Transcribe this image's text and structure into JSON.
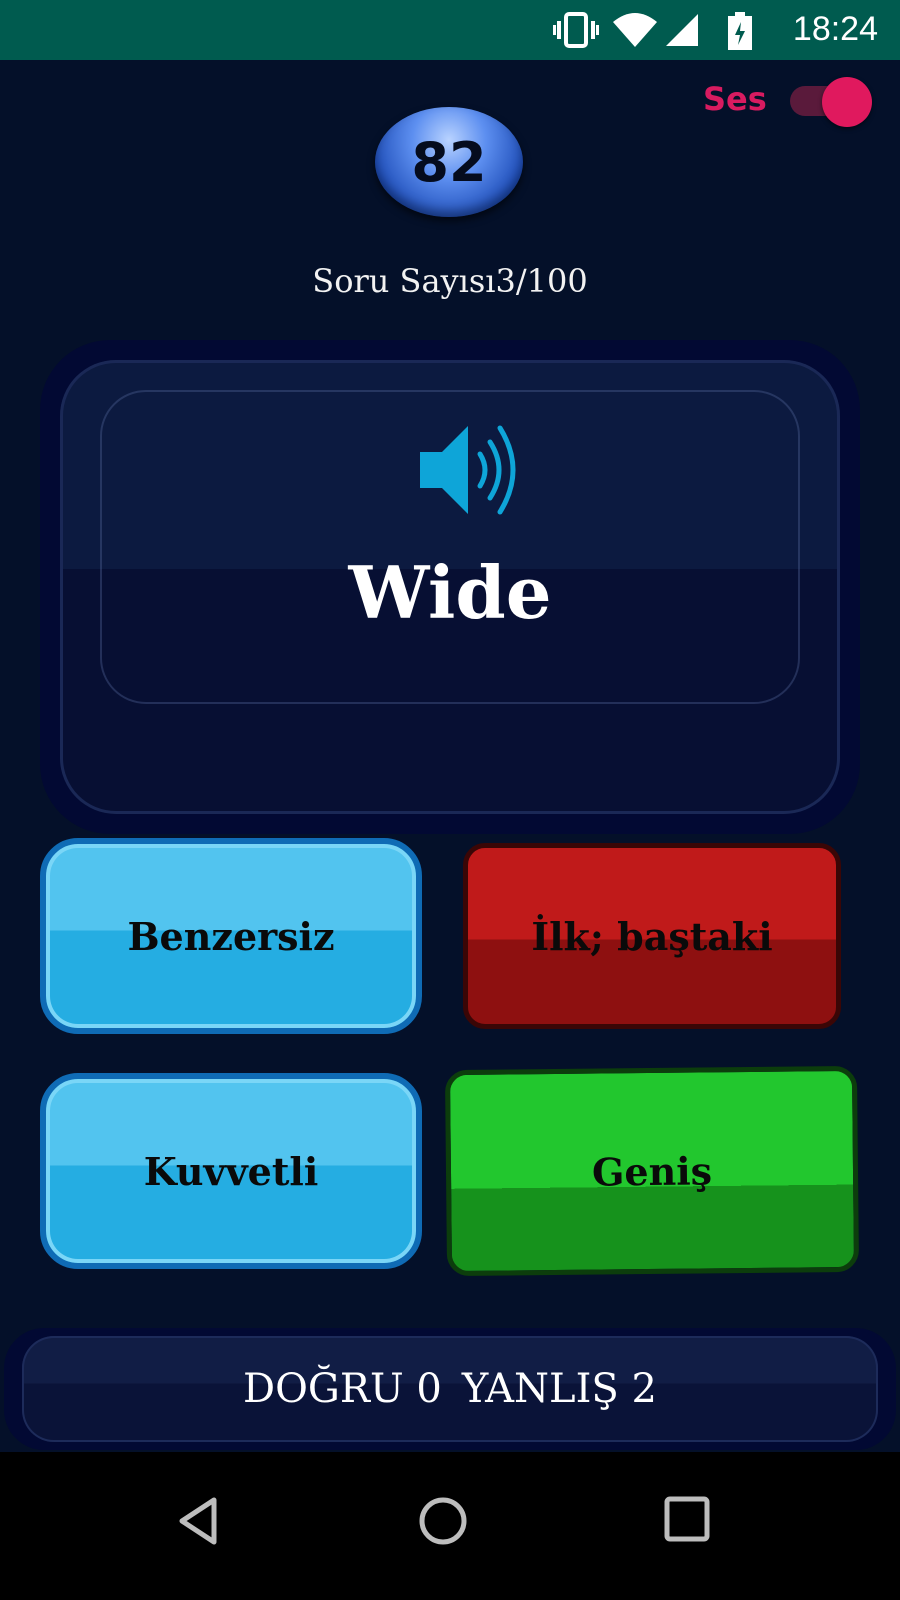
{
  "status_bar": {
    "time": "18:24",
    "icons": [
      "vibrate-icon",
      "wifi-icon",
      "signal-icon",
      "battery-charging-icon"
    ]
  },
  "sound": {
    "label": "Ses",
    "enabled": true,
    "accent_color": "#d81b60"
  },
  "score": {
    "value": "82"
  },
  "question_count": {
    "text": "Soru Sayısı3/100"
  },
  "word_card": {
    "word": "Wide",
    "speaker_icon": "speaker-icon",
    "speaker_color": "#0ea5d8"
  },
  "answers": [
    {
      "label": "Benzersiz",
      "state": "neutral",
      "color": "#25ade2"
    },
    {
      "label": "İlk; baştaki",
      "state": "wrong",
      "color": "#c01a1a"
    },
    {
      "label": "Kuvvetli",
      "state": "neutral",
      "color": "#25ade2"
    },
    {
      "label": "Geniş",
      "state": "correct",
      "color": "#22c72e"
    }
  ],
  "results": {
    "correct_label": "DOĞRU 0",
    "wrong_label": "YANLIŞ 2"
  },
  "nav": {
    "icons": [
      "back-icon",
      "home-icon",
      "recents-icon"
    ]
  },
  "theme": {
    "background": "#041029",
    "status_bar": "#005b4f"
  }
}
